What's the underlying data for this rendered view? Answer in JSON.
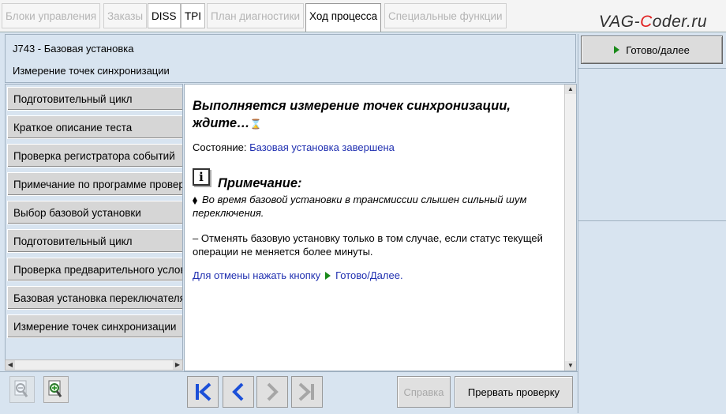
{
  "tabs": [
    {
      "label": "Блоки управления",
      "state": "disabled"
    },
    {
      "label": "Заказы",
      "state": "disabled"
    },
    {
      "label": "DISS",
      "state": "enabled"
    },
    {
      "label": "TPI",
      "state": "enabled"
    },
    {
      "label": "План диагностики",
      "state": "disabled"
    },
    {
      "label": "Ход процесса",
      "state": "active"
    },
    {
      "label": "Специальные функции",
      "state": "disabled"
    }
  ],
  "logo": {
    "before": "VAG-",
    "accent": "C",
    "after": "oder.ru"
  },
  "header": {
    "line1": "J743 - Базовая установка",
    "line2": "Измерение точек синхронизации"
  },
  "ready_button": {
    "label": "Готово/далее",
    "icon": "play-triangle-icon"
  },
  "steps": [
    "Подготовительный цикл",
    "Краткое описание теста",
    "Проверка регистратора событий",
    "Примечание по программе проверки",
    "Выбор базовой установки",
    "Подготовительный цикл",
    "Проверка предварительного условия",
    "Базовая установка переключателя",
    "Измерение точек синхронизации"
  ],
  "content": {
    "title": "Выполняется измерение точек синхронизации, ждите…",
    "hourglass_icon": "⌛",
    "state_label": "Состояние:",
    "state_value": "Базовая установка завершена",
    "note_heading": "Примечание:",
    "note_bullet": "Во время базовой установки в трансмиссии слышен сильный шум переключения.",
    "note_text": "– Отменять базовую установку только в том случае, если статус текущей операции не меняется более минуты.",
    "cancel_prefix": "Для отмены нажать кнопку",
    "cancel_link": "Готово/Далее."
  },
  "bottom": {
    "help_label": "Справка",
    "abort_label": "Прервать проверку"
  },
  "colors": {
    "accent_link": "#1f2fb0",
    "play_green": "#1a8a1a",
    "nav_blue": "#1b4fd8",
    "panel_bg": "#d8e4f0"
  }
}
